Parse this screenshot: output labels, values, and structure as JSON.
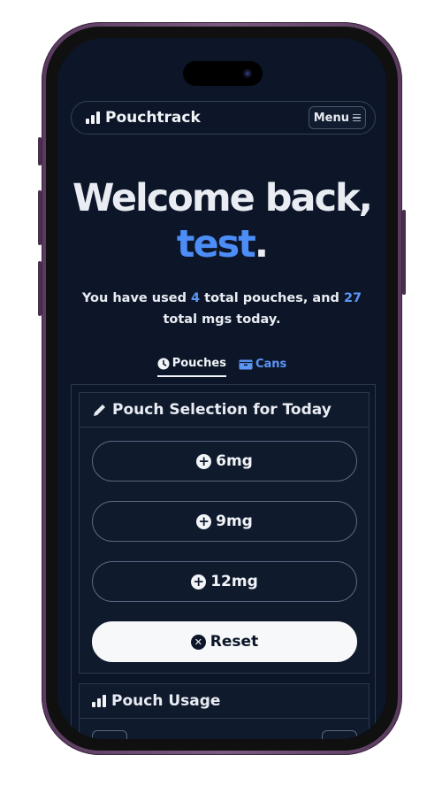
{
  "nav": {
    "brand": "Pouchtrack",
    "menu_label": "Menu"
  },
  "hero": {
    "greeting": "Welcome back,",
    "username": "test",
    "punct": "."
  },
  "summary": {
    "prefix": "You have used ",
    "pouch_count": "4",
    "middle": " total pouches, and ",
    "mg_count": "27",
    "suffix": " total mgs today."
  },
  "tabs": [
    {
      "label": "Pouches",
      "icon": "clock-icon",
      "active": true
    },
    {
      "label": "Cans",
      "icon": "can-icon",
      "active": false
    }
  ],
  "selection_card": {
    "title": "Pouch Selection for Today",
    "icon": "pencil-icon",
    "options": [
      {
        "label": "6mg",
        "icon": "plus-circle-icon"
      },
      {
        "label": "9mg",
        "icon": "plus-circle-icon"
      },
      {
        "label": "12mg",
        "icon": "plus-circle-icon"
      }
    ],
    "reset_label": "Reset"
  },
  "usage_card": {
    "title": "Pouch Usage",
    "icon": "bar-chart-icon"
  },
  "colors": {
    "background": "#0c1628",
    "accent": "#4d8df7",
    "frame": "#6b4a70"
  }
}
